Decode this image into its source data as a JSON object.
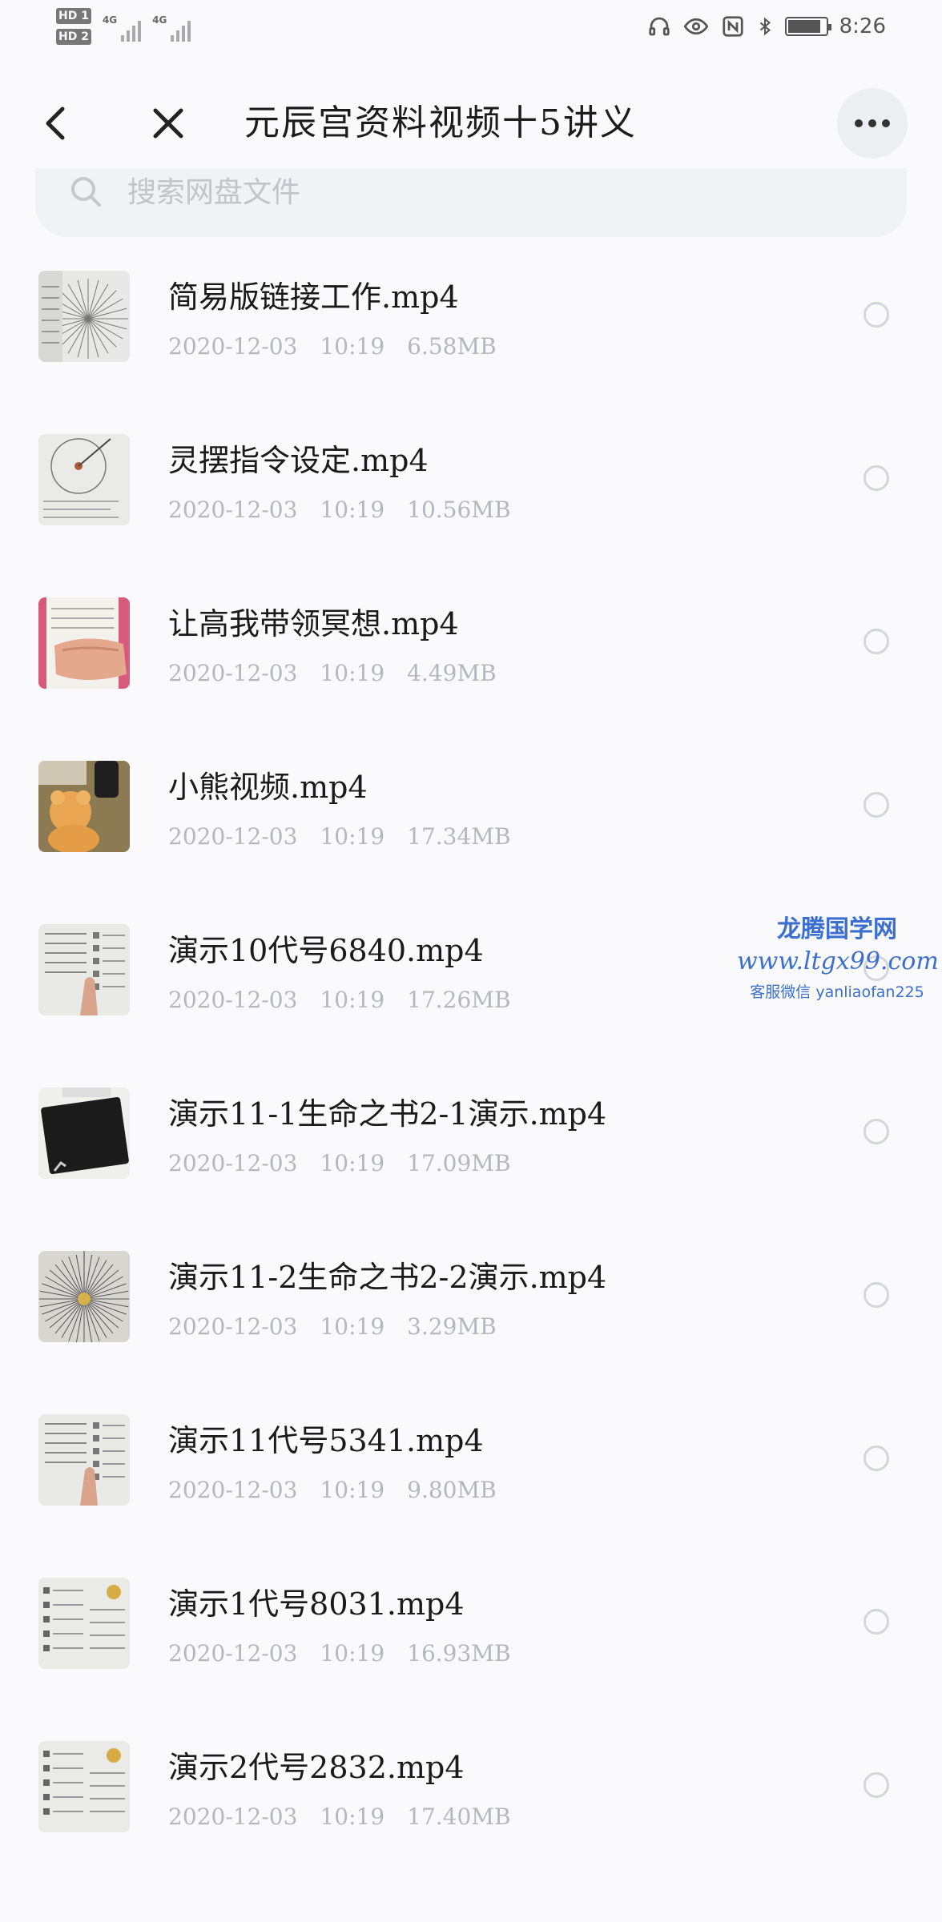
{
  "status_bar": {
    "hd1": "HD 1",
    "hd2": "HD 2",
    "net1": "4G",
    "net2": "4G",
    "time": "8:26",
    "icons": [
      "headphones-icon",
      "eye-icon",
      "nfc-icon",
      "bluetooth-icon",
      "battery-icon"
    ]
  },
  "header": {
    "title": "元辰宫资料视频十5讲义",
    "back_icon": "chevron-left-icon",
    "close_icon": "close-icon",
    "more_icon": "more-dots-icon"
  },
  "search": {
    "placeholder": "搜索网盘文件",
    "icon": "search-icon"
  },
  "files": [
    {
      "name": "简易版链接工作.mp4",
      "date": "2020-12-03",
      "time": "10:19",
      "size": "6.58MB",
      "thumb": "pendulum-chart"
    },
    {
      "name": "灵摆指令设定.mp4",
      "date": "2020-12-03",
      "time": "10:19",
      "size": "10.56MB",
      "thumb": "pendulum-circle"
    },
    {
      "name": "让高我带领冥想.mp4",
      "date": "2020-12-03",
      "time": "10:19",
      "size": "4.49MB",
      "thumb": "hand-paper"
    },
    {
      "name": "小熊视频.mp4",
      "date": "2020-12-03",
      "time": "10:19",
      "size": "17.34MB",
      "thumb": "teddy-bear"
    },
    {
      "name": "演示10代号6840.mp4",
      "date": "2020-12-03",
      "time": "10:19",
      "size": "17.26MB",
      "thumb": "document-finger"
    },
    {
      "name": "演示11-1生命之书2-1演示.mp4",
      "date": "2020-12-03",
      "time": "10:19",
      "size": "17.09MB",
      "thumb": "black-book"
    },
    {
      "name": "演示11-2生命之书2-2演示.mp4",
      "date": "2020-12-03",
      "time": "10:19",
      "size": "3.29MB",
      "thumb": "pendulum-gold"
    },
    {
      "name": "演示11代号5341.mp4",
      "date": "2020-12-03",
      "time": "10:19",
      "size": "9.80MB",
      "thumb": "document-finger"
    },
    {
      "name": "演示1代号8031.mp4",
      "date": "2020-12-03",
      "time": "10:19",
      "size": "16.93MB",
      "thumb": "document-gold"
    },
    {
      "name": "演示2代号2832.mp4",
      "date": "2020-12-03",
      "time": "10:19",
      "size": "17.40MB",
      "thumb": "document-gold"
    }
  ],
  "watermark": {
    "line1": "龙腾国学网",
    "line2": "www.ltgx99.com",
    "line3": "客服微信 yanliaofan225"
  }
}
